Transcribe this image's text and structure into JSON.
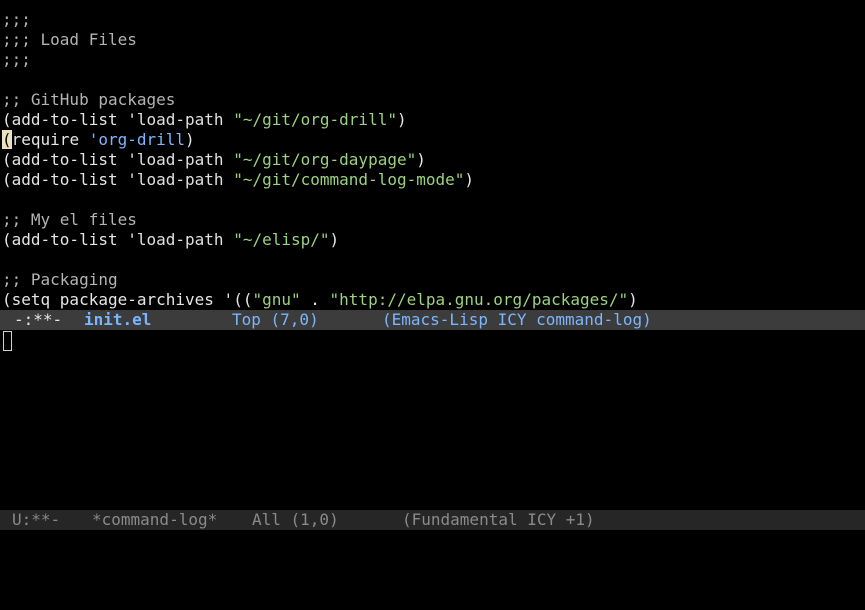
{
  "editor": {
    "lines": [
      {
        "parts": [
          {
            "text": ";;;",
            "cls": "c-comment"
          }
        ]
      },
      {
        "parts": [
          {
            "text": ";;; Load Files",
            "cls": "c-comment"
          }
        ]
      },
      {
        "parts": [
          {
            "text": ";;;",
            "cls": "c-comment"
          }
        ]
      },
      {
        "parts": []
      },
      {
        "parts": [
          {
            "text": ";; GitHub packages",
            "cls": "c-comment"
          }
        ]
      },
      {
        "parts": [
          {
            "text": "(add-to-list ",
            "cls": "c-fn"
          },
          {
            "text": "'load-path ",
            "cls": "c-quote"
          },
          {
            "text": "\"~/git/org-drill\"",
            "cls": "c-string"
          },
          {
            "text": ")",
            "cls": "c-fn"
          }
        ]
      },
      {
        "parts": [
          {
            "text": "(",
            "cls": "cursor-char"
          },
          {
            "text": "require ",
            "cls": "c-fn"
          },
          {
            "text": "'org-drill",
            "cls": "c-kw"
          },
          {
            "text": ")",
            "cls": "c-fn"
          }
        ]
      },
      {
        "parts": [
          {
            "text": "(add-to-list ",
            "cls": "c-fn"
          },
          {
            "text": "'load-path ",
            "cls": "c-quote"
          },
          {
            "text": "\"~/git/org-daypage\"",
            "cls": "c-string"
          },
          {
            "text": ")",
            "cls": "c-fn"
          }
        ]
      },
      {
        "parts": [
          {
            "text": "(add-to-list ",
            "cls": "c-fn"
          },
          {
            "text": "'load-path ",
            "cls": "c-quote"
          },
          {
            "text": "\"~/git/command-log-mode\"",
            "cls": "c-string"
          },
          {
            "text": ")",
            "cls": "c-fn"
          }
        ]
      },
      {
        "parts": []
      },
      {
        "parts": [
          {
            "text": ";; My el files",
            "cls": "c-comment"
          }
        ]
      },
      {
        "parts": [
          {
            "text": "(add-to-list ",
            "cls": "c-fn"
          },
          {
            "text": "'load-path ",
            "cls": "c-quote"
          },
          {
            "text": "\"~/elisp/\"",
            "cls": "c-string"
          },
          {
            "text": ")",
            "cls": "c-fn"
          }
        ]
      },
      {
        "parts": []
      },
      {
        "parts": [
          {
            "text": ";; Packaging",
            "cls": "c-comment"
          }
        ]
      },
      {
        "parts": [
          {
            "text": "(setq package-archives '((",
            "cls": "c-fn"
          },
          {
            "text": "\"gnu\"",
            "cls": "c-string"
          },
          {
            "text": " . ",
            "cls": "c-fn"
          },
          {
            "text": "\"http://elpa.gnu.org/packages/\"",
            "cls": "c-string"
          },
          {
            "text": ")",
            "cls": "c-fn"
          }
        ]
      }
    ]
  },
  "modeline_active": {
    "status": "-:**-",
    "buffer": "init.el",
    "position": "Top (7,0)",
    "modes": "(Emacs-Lisp ICY command-log)"
  },
  "modeline_inactive": {
    "status": "U:**-",
    "buffer": "*command-log*",
    "position": "All (1,0)",
    "modes": "(Fundamental ICY +1)"
  },
  "colors": {
    "background": "#000000",
    "comment": "#b3b3b3",
    "string": "#9ad27e",
    "keyword": "#7ab6ff",
    "modeline_active_bg": "#3c3c3c",
    "modeline_inactive_bg": "#262626"
  }
}
